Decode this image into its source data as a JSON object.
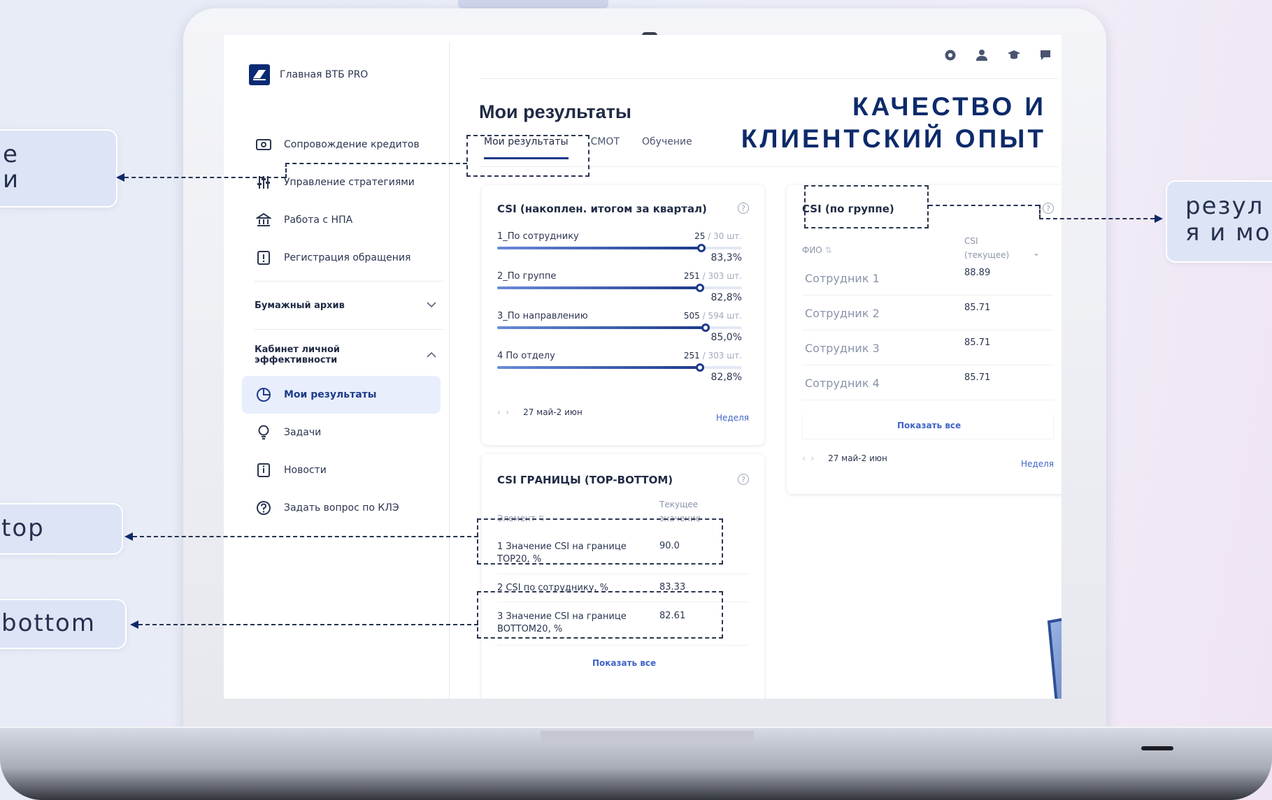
{
  "brand": {
    "name": "Главная ВТБ PRO",
    "logo_text": "PRO"
  },
  "headline": {
    "line1": "КАЧЕСТВО И",
    "line2": "КЛИЕНТСКИЙ ОПЫТ"
  },
  "sidebar": {
    "items": [
      {
        "label": "Сопровождение кредитов",
        "icon": "money-icon"
      },
      {
        "label": "Управление стратегиями",
        "icon": "sliders-icon"
      },
      {
        "label": "Работа с НПА",
        "icon": "bank-icon"
      },
      {
        "label": "Регистрация обращения",
        "icon": "note-icon"
      }
    ],
    "archive_label": "Бумажный архив",
    "cabinet_label_line1": "Кабинет личной",
    "cabinet_label_line2": "эффективности",
    "sub_items": [
      {
        "label": "Мои результаты",
        "icon": "pie-chart-icon",
        "active": true
      },
      {
        "label": "Задачи",
        "icon": "lightbulb-icon"
      },
      {
        "label": "Новости",
        "icon": "news-icon"
      },
      {
        "label": "Задать вопрос по КЛЭ",
        "icon": "question-icon"
      }
    ]
  },
  "header_icons": [
    "gear-icon",
    "users-icon",
    "graduation-icon",
    "chat-icon"
  ],
  "page": {
    "title": "Мои результаты",
    "tabs": [
      {
        "label": "Мои результаты",
        "active": true
      },
      {
        "label": "СМОТ"
      },
      {
        "label": "Обучение"
      }
    ]
  },
  "csi_card": {
    "title": "CSI (накоплен. итогом за квартал)",
    "rows": [
      {
        "label": "1_По сотруднику",
        "count": "25",
        "total": "/ 30 шт.",
        "percent": "83,3%",
        "level": 0.833
      },
      {
        "label": "2_По группе",
        "count": "251",
        "total": "/ 303 шт.",
        "percent": "82,8%",
        "level": 0.828
      },
      {
        "label": "3_По направлению",
        "count": "505",
        "total": "/ 594 шт.",
        "percent": "85,0%",
        "level": 0.85
      },
      {
        "label": "4  По отделу",
        "count": "251",
        "total": "/ 303 шт.",
        "percent": "82,8%",
        "level": 0.828
      }
    ],
    "period": "27 май-2 июн",
    "period_link": "Неделя"
  },
  "group_card": {
    "title": "CSI (по группе)",
    "col_name": "ФИО",
    "col_value_line1": "CSI",
    "col_value_line2": "(текущее)",
    "rows": [
      {
        "name": "Сотрудник 1",
        "value": "88.89"
      },
      {
        "name": "Сотрудник 2",
        "value": "85.71"
      },
      {
        "name": "Сотрудник 3",
        "value": "85.71"
      },
      {
        "name": "Сотрудник 4",
        "value": "85.71"
      }
    ],
    "show_all": "Показать все",
    "period": "27 май-2 июн",
    "period_link": "Неделя"
  },
  "border_card": {
    "title": "CSI ГРАНИЦЫ (TOP-BOTTOM)",
    "col_name": "Элемент",
    "col_value_line1": "Текущее",
    "col_value_line2": "значение",
    "rows": [
      {
        "name": "1 Значение CSI на границе TOP20, %",
        "value": "90.0"
      },
      {
        "name": "2 CSI по сотруднику, %",
        "value": "83.33"
      },
      {
        "name": "3 Значение CSI на границе BOTTOM20, %",
        "value": "82.61"
      }
    ],
    "show_all": "Показать все"
  },
  "callouts": {
    "left_top_line1": "е",
    "left_top_line2": "и",
    "top": "top",
    "bottom": "bottom",
    "right_line1": "резул",
    "right_line2": "я и мо"
  },
  "colors": {
    "accent": "#1e3a8a",
    "link": "#3f63c7",
    "headline": "#0d2a6b"
  }
}
